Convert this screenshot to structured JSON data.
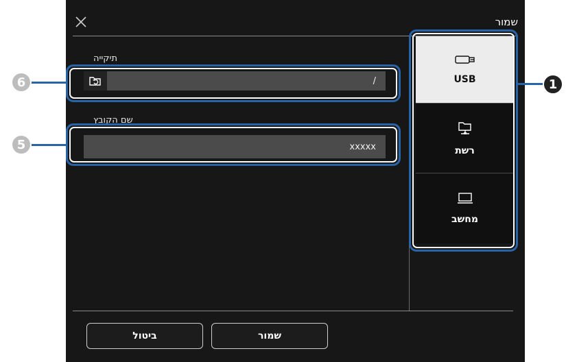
{
  "dialog": {
    "title": "שמור",
    "close_icon": "close-icon"
  },
  "folder": {
    "label": "תיקייה",
    "value": "/",
    "icon": "folder-refresh-icon"
  },
  "filename": {
    "label": "שם הקובץ",
    "value": "xxxxx"
  },
  "destinations": [
    {
      "label": "USB",
      "icon": "usb-drive-icon",
      "selected": true
    },
    {
      "label": "רשת",
      "icon": "network-folder-icon",
      "selected": false
    },
    {
      "label": "מחשב",
      "icon": "computer-icon",
      "selected": false
    }
  ],
  "footer": {
    "save_label": "שמור",
    "cancel_label": "ביטול"
  },
  "callouts": [
    "6",
    "5",
    "1"
  ],
  "colors": {
    "accent": "#2a64a8",
    "dialog_bg": "#171717",
    "field_bg": "#4b4b4b",
    "selected_bg": "#ececec"
  }
}
